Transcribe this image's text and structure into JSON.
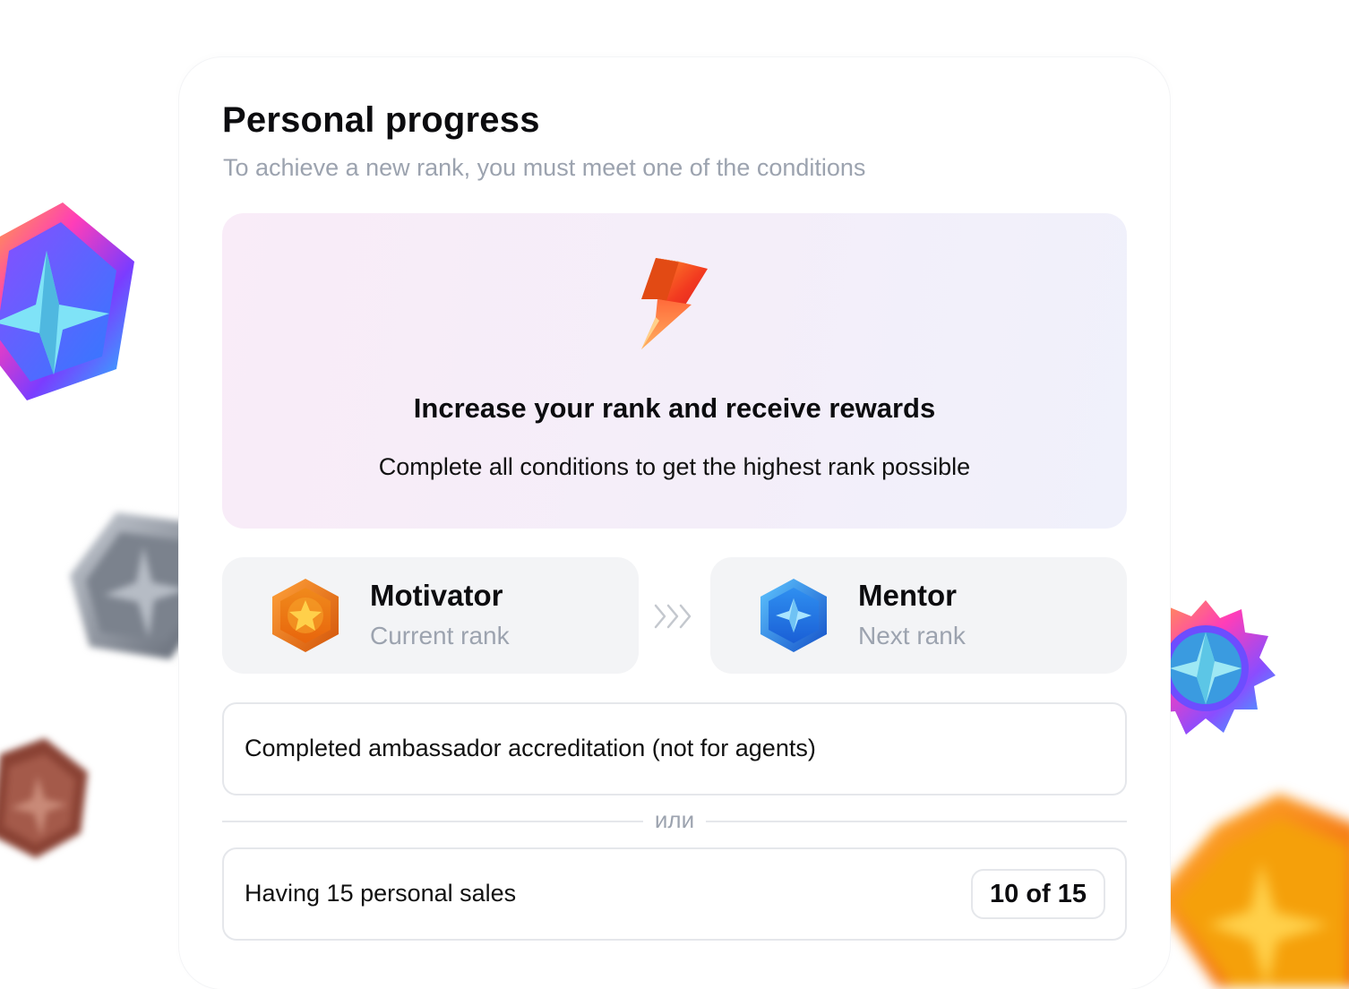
{
  "header": {
    "title": "Personal progress",
    "subtitle": "To achieve a new rank, you must meet one of the conditions"
  },
  "hero": {
    "icon": "lightning-icon",
    "title": "Increase your rank and receive rewards",
    "text": "Complete all conditions to get the highest rank possible"
  },
  "ranks": {
    "current": {
      "name": "Motivator",
      "label": "Current rank",
      "icon": "bronze-rank-badge-icon"
    },
    "next": {
      "name": "Mentor",
      "label": "Next rank",
      "icon": "blue-rank-badge-icon"
    }
  },
  "conditions": [
    {
      "text": "Completed ambassador accreditation (not for agents)"
    },
    {
      "text": "Having 15 personal sales",
      "progress": "10 of 15"
    }
  ],
  "separator": "или",
  "colors": {
    "hero_bg_start": "#f9ecf8",
    "hero_bg_end": "#f0f1fb",
    "muted_text": "#9ca3af",
    "card_bg": "#f3f4f6",
    "border": "#e5e7eb"
  }
}
